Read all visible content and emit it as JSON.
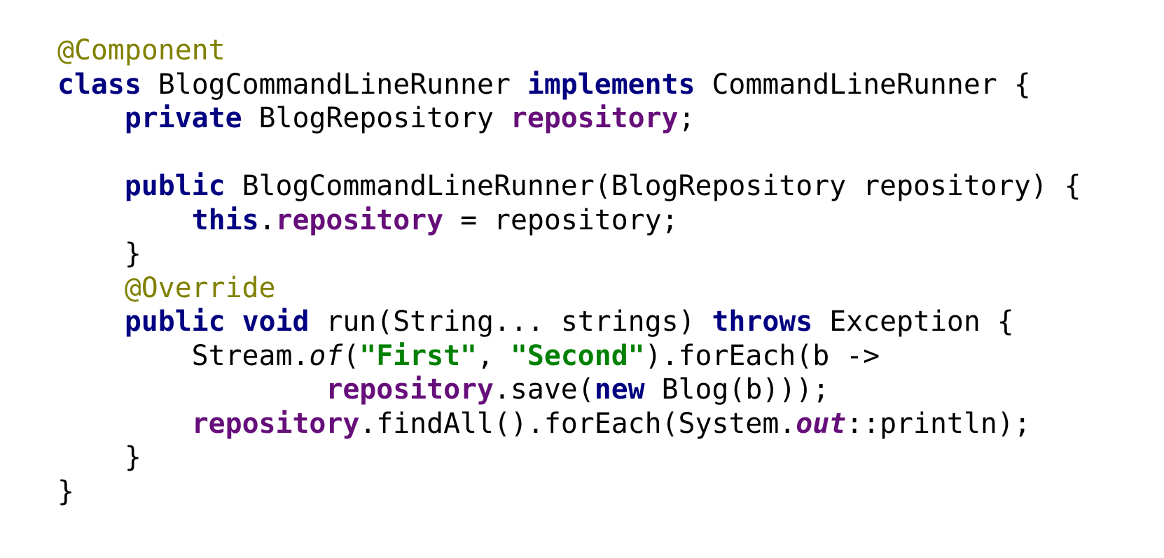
{
  "colors": {
    "background": "#ffffff",
    "plain": "#000000",
    "keyword": "#000080",
    "annotation": "#808000",
    "field": "#660e7a",
    "string": "#008000"
  },
  "code_lines": [
    [
      {
        "t": "@Component",
        "k": "annotation"
      }
    ],
    [
      {
        "t": "class",
        "k": "keyword"
      },
      {
        "t": " BlogCommandLineRunner ",
        "k": "plain"
      },
      {
        "t": "implements",
        "k": "keyword"
      },
      {
        "t": " CommandLineRunner {",
        "k": "plain"
      }
    ],
    [
      {
        "t": "    ",
        "k": "plain"
      },
      {
        "t": "private",
        "k": "keyword"
      },
      {
        "t": " BlogRepository ",
        "k": "plain"
      },
      {
        "t": "repository",
        "k": "field"
      },
      {
        "t": ";",
        "k": "plain"
      }
    ],
    [],
    [
      {
        "t": "    ",
        "k": "plain"
      },
      {
        "t": "public",
        "k": "keyword"
      },
      {
        "t": " BlogCommandLineRunner(BlogRepository repository) {",
        "k": "plain"
      }
    ],
    [
      {
        "t": "        ",
        "k": "plain"
      },
      {
        "t": "this",
        "k": "keyword"
      },
      {
        "t": ".",
        "k": "plain"
      },
      {
        "t": "repository",
        "k": "field"
      },
      {
        "t": " = repository;",
        "k": "plain"
      }
    ],
    [
      {
        "t": "    }",
        "k": "plain"
      }
    ],
    [
      {
        "t": "    ",
        "k": "plain"
      },
      {
        "t": "@Override",
        "k": "annotation"
      }
    ],
    [
      {
        "t": "    ",
        "k": "plain"
      },
      {
        "t": "public",
        "k": "keyword"
      },
      {
        "t": " ",
        "k": "plain"
      },
      {
        "t": "void",
        "k": "keyword"
      },
      {
        "t": " run(String... strings) ",
        "k": "plain"
      },
      {
        "t": "throws",
        "k": "keyword"
      },
      {
        "t": " Exception {",
        "k": "plain"
      }
    ],
    [
      {
        "t": "        Stream.",
        "k": "plain"
      },
      {
        "t": "of",
        "k": "static-method"
      },
      {
        "t": "(",
        "k": "plain"
      },
      {
        "t": "\"First\"",
        "k": "string"
      },
      {
        "t": ", ",
        "k": "plain"
      },
      {
        "t": "\"Second\"",
        "k": "string"
      },
      {
        "t": ").forEach(b ->",
        "k": "plain"
      }
    ],
    [
      {
        "t": "                ",
        "k": "plain"
      },
      {
        "t": "repository",
        "k": "field"
      },
      {
        "t": ".save(",
        "k": "plain"
      },
      {
        "t": "new",
        "k": "keyword"
      },
      {
        "t": " Blog(b)));",
        "k": "plain"
      }
    ],
    [
      {
        "t": "        ",
        "k": "plain"
      },
      {
        "t": "repository",
        "k": "field"
      },
      {
        "t": ".findAll().forEach(System.",
        "k": "plain"
      },
      {
        "t": "out",
        "k": "static-field"
      },
      {
        "t": "::println);",
        "k": "plain"
      }
    ],
    [
      {
        "t": "    }",
        "k": "plain"
      }
    ],
    [
      {
        "t": "}",
        "k": "plain"
      }
    ]
  ]
}
